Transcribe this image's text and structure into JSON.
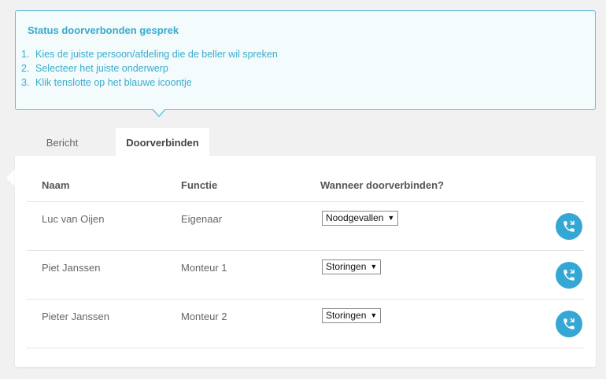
{
  "status": {
    "title": "Status doorverbonden gesprek",
    "steps": [
      {
        "num": "1.",
        "text": "Kies de juiste persoon/afdeling die de beller wil spreken"
      },
      {
        "num": "2.",
        "text": "Selecteer het juiste onderwerp"
      },
      {
        "num": "3.",
        "text": "Klik tenslotte op het blauwe icoontje"
      }
    ]
  },
  "tabs": [
    {
      "label": "Bericht",
      "active": false
    },
    {
      "label": "Doorverbinden",
      "active": true
    }
  ],
  "table": {
    "headers": {
      "name": "Naam",
      "function": "Functie",
      "when": "Wanneer doorverbinden?"
    },
    "rows": [
      {
        "name": "Luc van Oijen",
        "function": "Eigenaar",
        "when": "Noodgevallen",
        "action_icon": "phone-transfer-icon"
      },
      {
        "name": "Piet Janssen",
        "function": "Monteur 1",
        "when": "Storingen",
        "action_icon": "phone-transfer-icon"
      },
      {
        "name": "Pieter Janssen",
        "function": "Monteur 2",
        "when": "Storingen",
        "action_icon": "phone-transfer-icon"
      }
    ]
  },
  "colors": {
    "accent": "#34a7d5",
    "status_text": "#38aacb",
    "status_border": "#5fc0d8",
    "status_bg": "#f3fbfd",
    "page_bg": "#f1f1f1"
  }
}
